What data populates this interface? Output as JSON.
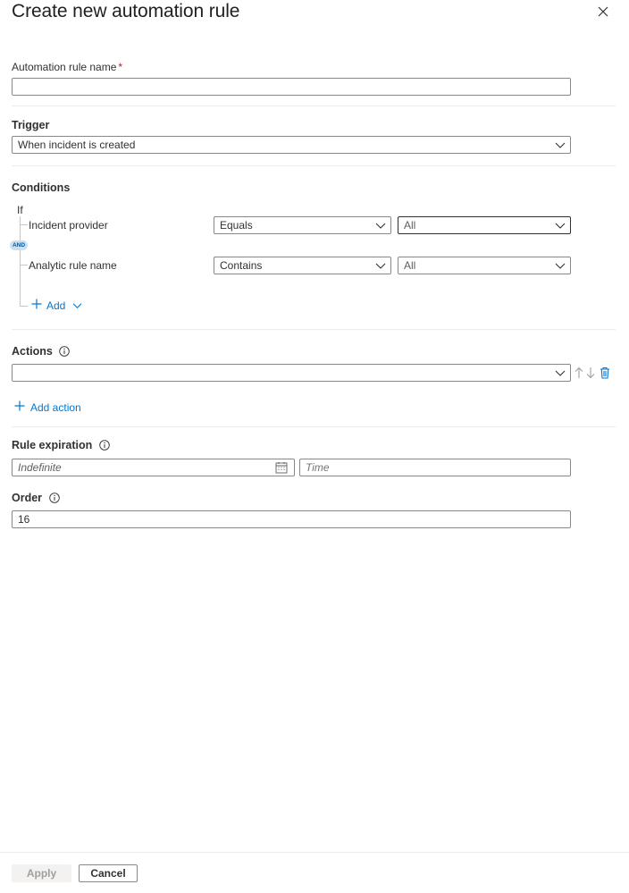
{
  "header": {
    "title": "Create new automation rule",
    "close_icon": "close-icon"
  },
  "rule_name": {
    "label": "Automation rule name",
    "required_mark": "*",
    "value": ""
  },
  "trigger": {
    "label": "Trigger",
    "selected": "When incident is created"
  },
  "conditions": {
    "label": "Conditions",
    "if_label": "If",
    "and_badge": "AND",
    "rows": [
      {
        "field": "Incident provider",
        "operator": "Equals",
        "value": "All"
      },
      {
        "field": "Analytic rule name",
        "operator": "Contains",
        "value": "All"
      }
    ],
    "add_label": "Add"
  },
  "actions": {
    "label": "Actions",
    "selected": "",
    "add_action_label": "Add action"
  },
  "rule_expiration": {
    "label": "Rule expiration",
    "date_placeholder": "Indefinite",
    "time_placeholder": "Time"
  },
  "order": {
    "label": "Order",
    "value": "16"
  },
  "footer": {
    "apply_label": "Apply",
    "cancel_label": "Cancel"
  },
  "colors": {
    "accent": "#0078d4",
    "required": "#a4262c",
    "border": "#8a8886"
  }
}
